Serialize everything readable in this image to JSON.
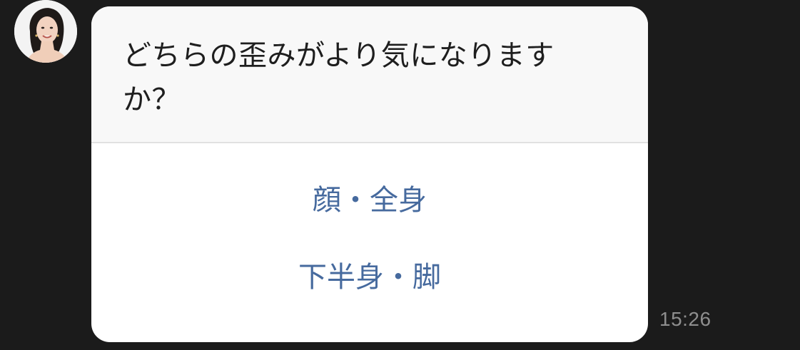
{
  "message": {
    "avatar_icon": "woman-portrait-avatar",
    "question": "どちらの歪みがより気になりますか？",
    "options": [
      {
        "label": "顔・全身"
      },
      {
        "label": "下半身・脚"
      }
    ],
    "timestamp": "15:26"
  },
  "colors": {
    "background": "#1b1b1b",
    "bubble": "#ffffff",
    "question_bg": "#f8f8f8",
    "option_text": "#466a9e",
    "timestamp": "#8e8e8e"
  }
}
